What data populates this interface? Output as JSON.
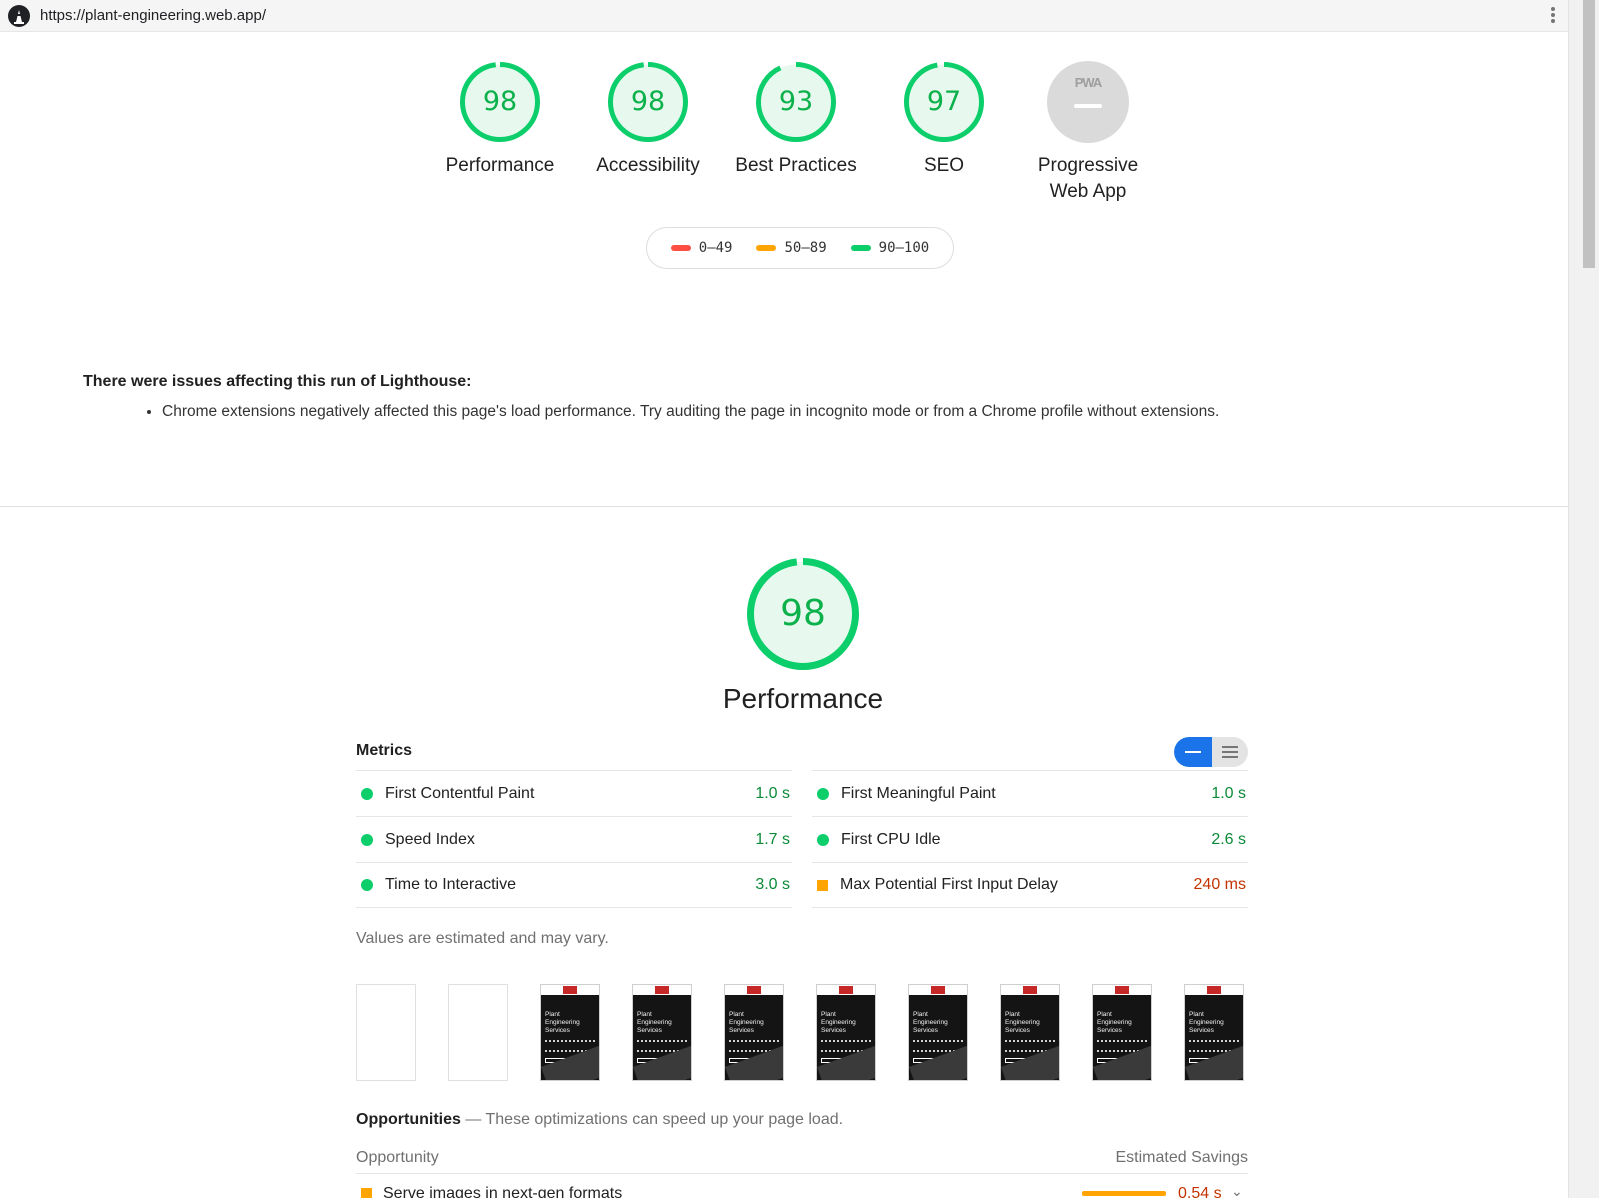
{
  "topbar": {
    "url": "https://plant-engineering.web.app/"
  },
  "gauges": [
    {
      "score": "98",
      "label": "Performance",
      "score_fraction": 0.98
    },
    {
      "score": "98",
      "label": "Accessibility",
      "score_fraction": 0.98
    },
    {
      "score": "93",
      "label": "Best Practices",
      "score_fraction": 0.93
    },
    {
      "score": "97",
      "label": "SEO",
      "score_fraction": 0.97
    }
  ],
  "pwa": {
    "badge": "PWA",
    "label_line1": "Progressive",
    "label_line2": "Web App"
  },
  "legend": [
    {
      "range": "0–49",
      "color": "#ff4e42"
    },
    {
      "range": "50–89",
      "color": "#ffa400"
    },
    {
      "range": "90–100",
      "color": "#0cce6b"
    }
  ],
  "warnings": {
    "title": "There were issues affecting this run of Lighthouse:",
    "items": [
      "Chrome extensions negatively affected this page's load performance. Try auditing the page in incognito mode or from a Chrome profile without extensions."
    ]
  },
  "performance": {
    "score": "98",
    "score_fraction": 0.98,
    "title": "Performance",
    "metrics_heading": "Metrics",
    "metrics_left": [
      {
        "label": "First Contentful Paint",
        "value": "1.0 s",
        "status": "pass"
      },
      {
        "label": "Speed Index",
        "value": "1.7 s",
        "status": "pass"
      },
      {
        "label": "Time to Interactive",
        "value": "3.0 s",
        "status": "pass"
      }
    ],
    "metrics_right": [
      {
        "label": "First Meaningful Paint",
        "value": "1.0 s",
        "status": "pass"
      },
      {
        "label": "First CPU Idle",
        "value": "2.6 s",
        "status": "pass"
      },
      {
        "label": "Max Potential First Input Delay",
        "value": "240 ms",
        "status": "average"
      }
    ],
    "estimated_note": "Values are estimated and may vary.",
    "filmstrip_text": "Plant Engineering Services"
  },
  "opportunities": {
    "heading": "Opportunities",
    "subheading": " — These optimizations can speed up your page load.",
    "col_opportunity": "Opportunity",
    "col_savings": "Estimated Savings",
    "rows": [
      {
        "label": "Serve images in next-gen formats",
        "savings": "0.54 s"
      }
    ]
  },
  "colors": {
    "pass": "#0cce6b",
    "average": "#ffa400",
    "fail": "#ff4e42",
    "accent": "#1a73e8"
  }
}
